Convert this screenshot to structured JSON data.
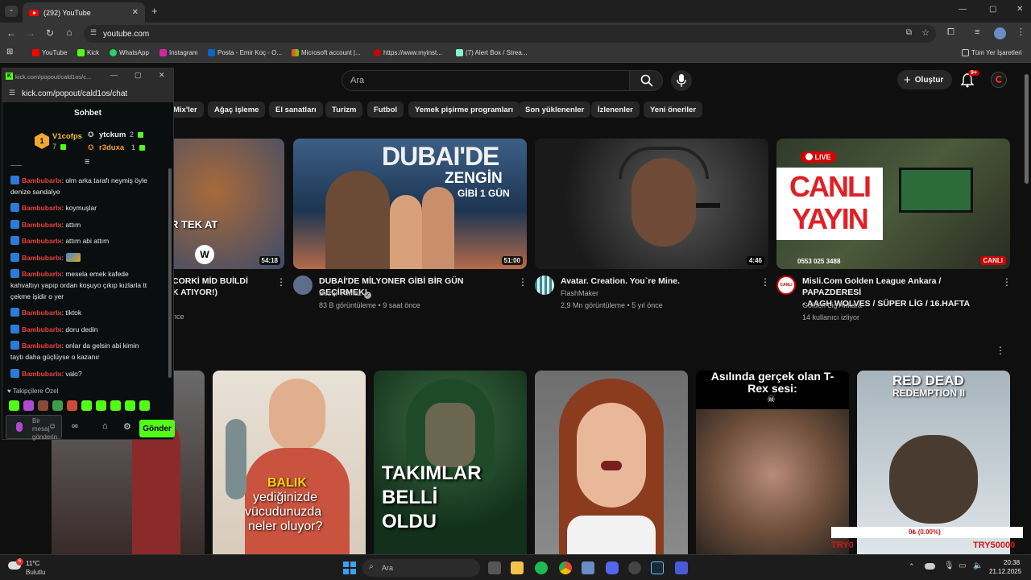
{
  "browser": {
    "tab_title": "(292) YouTube",
    "url": "youtube.com",
    "bookmarks": [
      "YouTube",
      "Kick",
      "WhatsApp",
      "Instagram",
      "Posta - Emir Koç - O...",
      "Microsoft account |...",
      "https://www.myinst...",
      "(7) Alert Box / Strea..."
    ],
    "all_bookmarks": "Tüm Yer İşaretleri"
  },
  "youtube": {
    "search_placeholder": "Ara",
    "create_label": "Oluştur",
    "notif_count": "9+",
    "chips": [
      "Mix'ler",
      "Ağaç işleme",
      "El sanatları",
      "Turizm",
      "Futbol",
      "Yemek pişirme programları",
      "Son yüklenenler",
      "İzlenenler",
      "Yeni öneriler"
    ],
    "videos": [
      {
        "title1": "CORKİ MİD BUİLDİ",
        "title2": "K ATIYOR!)",
        "meta": "nce",
        "duration": "54:18",
        "thumb_text": "R TEK AT"
      },
      {
        "title": "DUBAİ'DE MİLYONER GİBİ BİR GÜN GEÇİRMEK!",
        "channel": "Sezer Yılmaz",
        "meta": "83 B görüntüleme • 9 saat önce",
        "duration": "51:00",
        "thumb_text1": "DUBAI'DE",
        "thumb_text2": "ZENGİN",
        "thumb_text3": "GİBİ 1 GÜN"
      },
      {
        "title": "Avatar. Creation. You`re Mine.",
        "channel": "FlashMaker",
        "meta": "2,9 Mn görüntüleme • 5 yıl önce",
        "duration": "4:46"
      },
      {
        "title1": "Misli.Com Golden League Ankara / PAPAZDERESİ",
        "title2": "- AAGH WOLVES / SÜPER LİG / 16.HAFTA",
        "channel": "Golden Lig Ankara",
        "meta": "14 kullanıcı izliyor",
        "live": "LIVE",
        "live_badge": "CANLI",
        "thumb_text1": "CANLI",
        "thumb_text2": "YAYIN",
        "phone": "0553 025 3488"
      }
    ],
    "shorts": [
      {
        "thumb_text1": "BALIK",
        "thumb_text2": "yediğinizde",
        "thumb_text3": "vücudunuzda",
        "thumb_text4": "neler oluyor?"
      },
      {
        "thumb_text1": "TAKIMLAR",
        "thumb_text2": "BELLİ",
        "thumb_text3": "OLDU"
      },
      {
        "thumb_text": "Asılında gerçek olan T-Rex sesi:"
      },
      {
        "thumb_text1": "RED DEAD",
        "thumb_text2": "REDEMPTION II"
      }
    ],
    "overlay": {
      "line1": "0₺ (0.00%)",
      "left": "TRY0",
      "right": "TRY50000"
    }
  },
  "kick": {
    "window_title": "kick.com/popout/cald1os/c...",
    "url": "kick.com/popout/cald1os/chat",
    "header": "Sohbet",
    "leaders": [
      {
        "name": "V1cofps",
        "count": "7"
      },
      {
        "name": "ytckum",
        "count": "2"
      },
      {
        "name": "r3duxa",
        "count": "1"
      }
    ],
    "messages": [
      {
        "user": "Bambubarbı",
        "text1": ": olm arka tarafı neymiş öyle",
        "text2": "denize sandalye"
      },
      {
        "user": "Bambubarbı",
        "text": ": koymuşlar"
      },
      {
        "user": "Bambubarbı",
        "text": ": attım"
      },
      {
        "user": "Bambubarbı",
        "text": ": attım abi attım"
      },
      {
        "user": "Bambubarbı",
        "text": ":"
      },
      {
        "user": "Bambubarbı",
        "text1": ": mesela emek kafede",
        "text2": "kahvaltıyı yapıp ordan koşuyo çıkıp kızlarla tt",
        "text3": "çekme işidir o yer"
      },
      {
        "user": "Bambubarbı",
        "text": ": tiktok"
      },
      {
        "user": "Bambubarbı",
        "text": ": doru dedin"
      },
      {
        "user": "Bambubarbı",
        "text1": ": onlar da gelsin abi kimin",
        "text2": "taytı daha güçlüyse o kazanır"
      },
      {
        "user": "Bambubarbı",
        "text": ": valo?"
      }
    ],
    "followers_label": "Takipçilere Özel",
    "input_placeholder": "Bir mesaj gönderin",
    "send_label": "Gönder"
  },
  "taskbar": {
    "temp": "11°C",
    "weather": "Bulutlu",
    "search": "Ara",
    "time": "20:38",
    "date": "21.12.2025"
  }
}
